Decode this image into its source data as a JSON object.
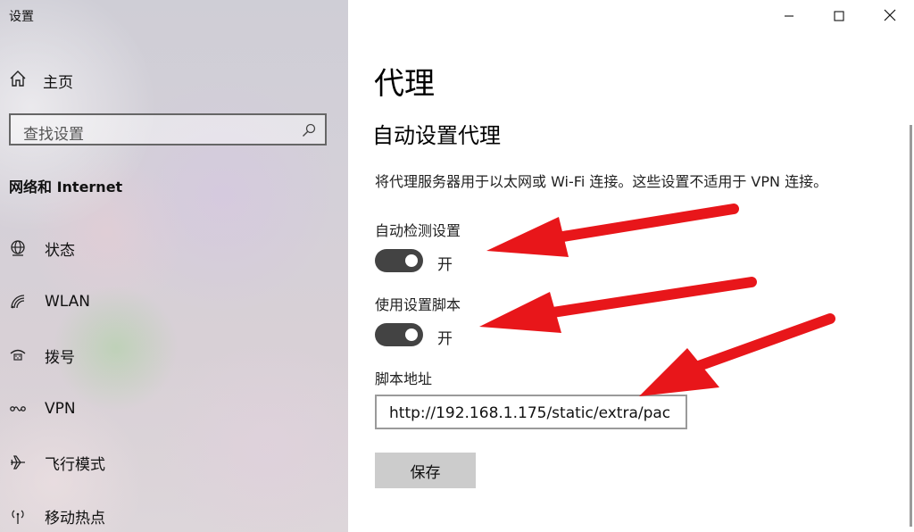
{
  "window": {
    "title": "设置",
    "minimize_icon": "minimize-icon",
    "maximize_icon": "maximize-icon",
    "close_icon": "close-icon"
  },
  "sidebar": {
    "home_label": "主页",
    "search_placeholder": "查找设置",
    "section_title": "网络和 Internet",
    "items": [
      {
        "label": "状态",
        "icon": "globe-status-icon"
      },
      {
        "label": "WLAN",
        "icon": "wifi-icon"
      },
      {
        "label": "拨号",
        "icon": "dialup-icon"
      },
      {
        "label": "VPN",
        "icon": "vpn-icon"
      },
      {
        "label": "飞行模式",
        "icon": "airplane-icon"
      },
      {
        "label": "移动热点",
        "icon": "hotspot-icon"
      }
    ]
  },
  "main": {
    "page_title": "代理",
    "subtitle": "自动设置代理",
    "description": "将代理服务器用于以太网或 Wi-Fi 连接。这些设置不适用于 VPN 连接。",
    "auto_detect": {
      "label": "自动检测设置",
      "state": "开",
      "on": true
    },
    "use_script": {
      "label": "使用设置脚本",
      "state": "开",
      "on": true
    },
    "script_address": {
      "label": "脚本地址",
      "value": "http://192.168.1.175/static/extra/pac"
    },
    "save_label": "保存"
  },
  "colors": {
    "toggle_on": "#434343",
    "annotation_arrow": "#e8161a"
  }
}
